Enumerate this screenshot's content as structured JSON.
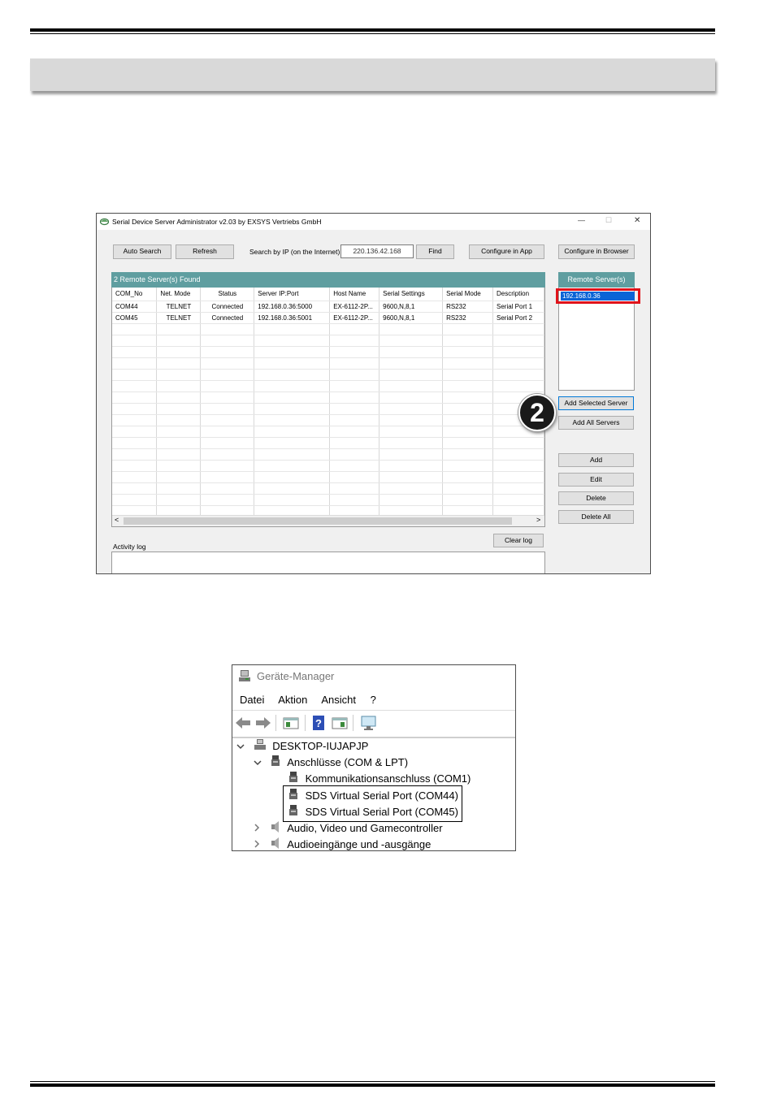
{
  "sds": {
    "title": "Serial Device Server Administrator v2.03 by EXSYS Vertriebs GmbH",
    "window_controls": {
      "minimize": "—",
      "maximize": "☐",
      "close": "✕"
    },
    "toolbar": {
      "auto_search": "Auto Search",
      "refresh": "Refresh",
      "search_label": "Search by IP (on the Internet)",
      "search_value": "220.136.42.168",
      "find": "Find",
      "configure_app": "Configure in App",
      "configure_browser": "Configure in Browser"
    },
    "found_header": "2 Remote Server(s) Found",
    "columns": [
      "COM_No",
      "Net. Mode",
      "Status",
      "Server IP:Port",
      "Host Name",
      "Serial Settings",
      "Serial Mode",
      "Description"
    ],
    "rows": [
      [
        "COM44",
        "TELNET",
        "Connected",
        "192.168.0.36:5000",
        "EX-6112-2P...",
        "9600,N,8,1",
        "RS232",
        "Serial Port 1"
      ],
      [
        "COM45",
        "TELNET",
        "Connected",
        "192.168.0.36:5001",
        "EX-6112-2P...",
        "9600,N,8,1",
        "RS232",
        "Serial Port 2"
      ]
    ],
    "remote_header": "Remote Server(s)",
    "remote_items": [
      "192.168.0.36"
    ],
    "buttons": {
      "add_selected": "Add Selected Server",
      "add_all": "Add All Servers",
      "add": "Add",
      "edit": "Edit",
      "delete": "Delete",
      "delete_all": "Delete All",
      "clear_log": "Clear log"
    },
    "activity_label": "Activity log",
    "step_badge": "2",
    "scroll_left": "<",
    "scroll_right": ">"
  },
  "devmgr": {
    "title": "Geräte-Manager",
    "menu": [
      "Datei",
      "Aktion",
      "Ansicht",
      "?"
    ],
    "tree": {
      "root": "DESKTOP-IUJAPJP",
      "category": "Anschlüsse (COM & LPT)",
      "ports": [
        "Kommunikationsanschluss (COM1)",
        "SDS Virtual Serial Port (COM44)",
        "SDS Virtual Serial Port (COM45)"
      ],
      "other1": "Audio, Video und Gamecontroller",
      "other2": "Audioeingänge und -ausgänge"
    },
    "expanded_glyph": "⌄",
    "collapsed_glyph": "›"
  }
}
